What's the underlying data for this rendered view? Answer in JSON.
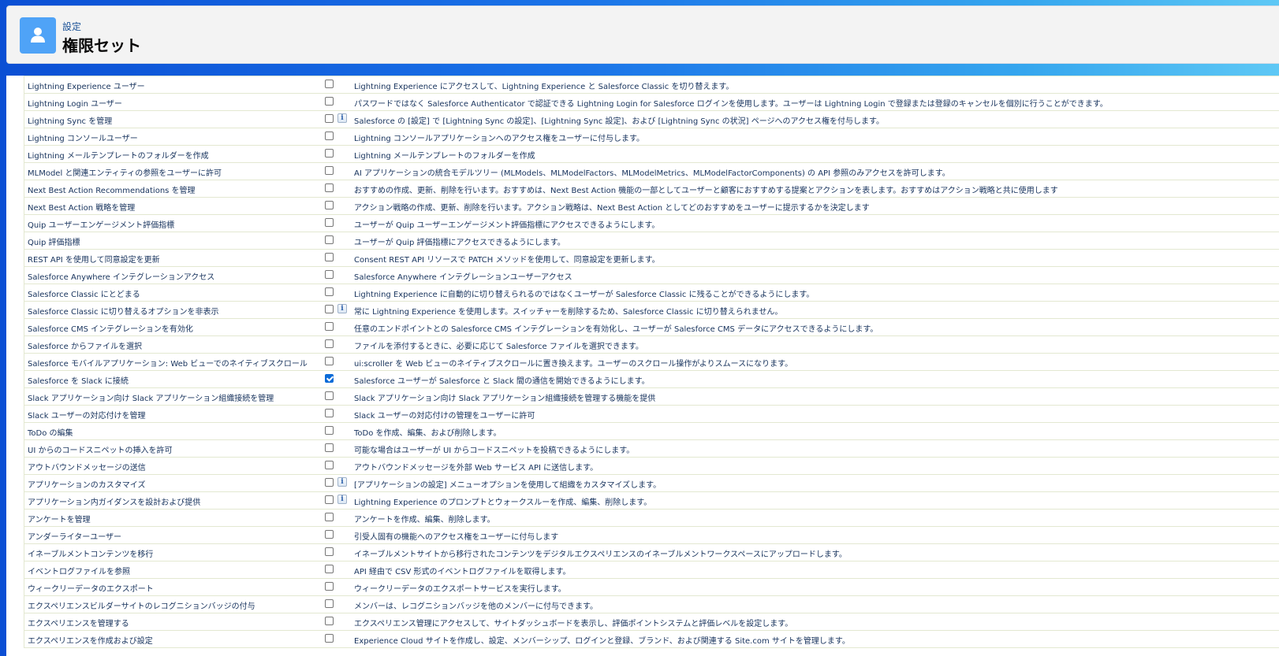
{
  "header": {
    "breadcrumb": "設定",
    "title": "権限セット",
    "avatar_icon": "user-icon",
    "avatar_color": "#4fa3f7"
  },
  "permissions": [
    {
      "name": "Lightning Experience ユーザー",
      "checked": false,
      "info": false,
      "description": "Lightning Experience にアクセスして、Lightning Experience と Salesforce Classic を切り替えます。"
    },
    {
      "name": "Lightning Login ユーザー",
      "checked": false,
      "info": false,
      "description": "パスワードではなく Salesforce Authenticator で認証できる Lightning Login for Salesforce ログインを使用します。ユーザーは Lightning Login で登録または登録のキャンセルを個別に行うことができます。"
    },
    {
      "name": "Lightning Sync を管理",
      "checked": false,
      "info": true,
      "description": "Salesforce の [設定] で [Lightning Sync の設定]、[Lightning Sync 設定]、および [Lightning Sync の状況] ページへのアクセス権を付与します。"
    },
    {
      "name": "Lightning コンソールユーザー",
      "checked": false,
      "info": false,
      "description": "Lightning コンソールアプリケーションへのアクセス権をユーザーに付与します。"
    },
    {
      "name": "Lightning メールテンプレートのフォルダーを作成",
      "checked": false,
      "info": false,
      "description": "Lightning メールテンプレートのフォルダーを作成"
    },
    {
      "name": "MLModel と関連エンティティの参照をユーザーに許可",
      "checked": false,
      "info": false,
      "description": "AI アプリケーションの統合モデルツリー (MLModels、MLModelFactors、MLModelMetrics、MLModelFactorComponents) の API 参照のみアクセスを許可します。"
    },
    {
      "name": "Next Best Action Recommendations を管理",
      "checked": false,
      "info": false,
      "description": "おすすめの作成、更新、削除を行います。おすすめは、Next Best Action 機能の一部としてユーザーと顧客におすすめする提案とアクションを表します。おすすめはアクション戦略と共に使用します"
    },
    {
      "name": "Next Best Action 戦略を管理",
      "checked": false,
      "info": false,
      "description": "アクション戦略の作成、更新、削除を行います。アクション戦略は、Next Best Action としてどのおすすめをユーザーに提示するかを決定します"
    },
    {
      "name": "Quip ユーザーエンゲージメント評価指標",
      "checked": false,
      "info": false,
      "description": "ユーザーが Quip ユーザーエンゲージメント評価指標にアクセスできるようにします。"
    },
    {
      "name": "Quip 評価指標",
      "checked": false,
      "info": false,
      "description": "ユーザーが Quip 評価指標にアクセスできるようにします。"
    },
    {
      "name": "REST API を使用して同意設定を更新",
      "checked": false,
      "info": false,
      "description": "Consent REST API リソースで PATCH メソッドを使用して、同意設定を更新します。"
    },
    {
      "name": "Salesforce Anywhere インテグレーションアクセス",
      "checked": false,
      "info": false,
      "description": "Salesforce Anywhere インテグレーションユーザーアクセス"
    },
    {
      "name": "Salesforce Classic にとどまる",
      "checked": false,
      "info": false,
      "description": "Lightning Experience に自動的に切り替えられるのではなくユーザーが Salesforce Classic に残ることができるようにします。"
    },
    {
      "name": "Salesforce Classic に切り替えるオプションを非表示",
      "checked": false,
      "info": true,
      "description": "常に Lightning Experience を使用します。スイッチャーを削除するため、Salesforce Classic に切り替えられません。"
    },
    {
      "name": "Salesforce CMS インテグレーションを有効化",
      "checked": false,
      "info": false,
      "description": "任意のエンドポイントとの Salesforce CMS インテグレーションを有効化し、ユーザーが Salesforce CMS データにアクセスできるようにします。"
    },
    {
      "name": "Salesforce からファイルを選択",
      "checked": false,
      "info": false,
      "description": "ファイルを添付するときに、必要に応じて Salesforce ファイルを選択できます。"
    },
    {
      "name": "Salesforce モバイルアプリケーション: Web ビューでのネイティブスクロール",
      "checked": false,
      "info": false,
      "description": "ui:scroller を Web ビューのネイティブスクロールに置き換えます。ユーザーのスクロール操作がよりスムースになります。"
    },
    {
      "name": "Salesforce を Slack に接続",
      "checked": true,
      "info": false,
      "description": "Salesforce ユーザーが Salesforce と Slack 間の通信を開始できるようにします。"
    },
    {
      "name": "Slack アプリケーション向け Slack アプリケーション組織接続を管理",
      "checked": false,
      "info": false,
      "description": "Slack アプリケーション向け Slack アプリケーション組織接続を管理する機能を提供"
    },
    {
      "name": "Slack ユーザーの対応付けを管理",
      "checked": false,
      "info": false,
      "description": "Slack ユーザーの対応付けの管理をユーザーに許可"
    },
    {
      "name": "ToDo の編集",
      "checked": false,
      "info": false,
      "description": "ToDo を作成、編集、および削除します。"
    },
    {
      "name": "UI からのコードスニペットの挿入を許可",
      "checked": false,
      "info": false,
      "description": "可能な場合はユーザーが UI からコードスニペットを投稿できるようにします。"
    },
    {
      "name": "アウトバウンドメッセージの送信",
      "checked": false,
      "info": false,
      "description": "アウトバウンドメッセージを外部 Web サービス API に送信します。"
    },
    {
      "name": "アプリケーションのカスタマイズ",
      "checked": false,
      "info": true,
      "description": "[アプリケーションの設定] メニューオプションを使用して組織をカスタマイズします。"
    },
    {
      "name": "アプリケーション内ガイダンスを設計および提供",
      "checked": false,
      "info": true,
      "description": "Lightning Experience のプロンプトとウォークスルーを作成、編集、削除します。"
    },
    {
      "name": "アンケートを管理",
      "checked": false,
      "info": false,
      "description": "アンケートを作成、編集、削除します。"
    },
    {
      "name": "アンダーライターユーザー",
      "checked": false,
      "info": false,
      "description": "引受人固有の機能へのアクセス権をユーザーに付与します"
    },
    {
      "name": "イネーブルメントコンテンツを移行",
      "checked": false,
      "info": false,
      "description": "イネーブルメントサイトから移行されたコンテンツをデジタルエクスペリエンスのイネーブルメントワークスペースにアップロードします。"
    },
    {
      "name": "イベントログファイルを参照",
      "checked": false,
      "info": false,
      "description": "API 経由で CSV 形式のイベントログファイルを取得します。"
    },
    {
      "name": "ウィークリーデータのエクスポート",
      "checked": false,
      "info": false,
      "description": "ウィークリーデータのエクスポートサービスを実行します。"
    },
    {
      "name": "エクスペリエンスビルダーサイトのレコグニションバッジの付与",
      "checked": false,
      "info": false,
      "description": "メンバーは、レコグニションバッジを他のメンバーに付与できます。"
    },
    {
      "name": "エクスペリエンスを管理する",
      "checked": false,
      "info": false,
      "description": "エクスペリエンス管理にアクセスして、サイトダッシュボードを表示し、評価ポイントシステムと評価レベルを設定します。"
    },
    {
      "name": "エクスペリエンスを作成および設定",
      "checked": false,
      "info": false,
      "description": "Experience Cloud サイトを作成し、設定、メンバーシップ、ログインと登録、ブランド、および関連する Site.com サイトを管理します。"
    }
  ]
}
